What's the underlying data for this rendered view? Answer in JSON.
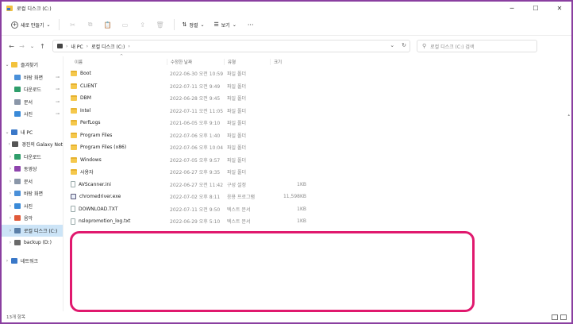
{
  "window": {
    "title": "로컬 디스크 (C:)",
    "minimize": "─",
    "maximize": "☐",
    "close": "✕"
  },
  "toolbar": {
    "new_label": "새로 만들기",
    "sort_label": "정렬",
    "view_label": "보기",
    "more": "···"
  },
  "address": {
    "crumbs": [
      "내 PC",
      "로컬 디스크 (C:)"
    ],
    "search_placeholder": "로컬 디스크 (C:) 검색"
  },
  "sidebar": {
    "items": [
      {
        "label": "즐겨찾기",
        "icon": "star-icon",
        "color": "#f3c23c",
        "arrow": "⌄",
        "indent": 0
      },
      {
        "label": "바탕 화면",
        "icon": "desktop-icon",
        "color": "#4a90d9",
        "arrow": "",
        "indent": 1,
        "pinned": true
      },
      {
        "label": "다운로드",
        "icon": "download-icon",
        "color": "#2f9e6b",
        "arrow": "",
        "indent": 1,
        "pinned": true
      },
      {
        "label": "문서",
        "icon": "document-icon",
        "color": "#8a96a8",
        "arrow": "",
        "indent": 1,
        "pinned": true
      },
      {
        "label": "사진",
        "icon": "picture-icon",
        "color": "#3a8ad8",
        "arrow": "",
        "indent": 1,
        "pinned": true
      },
      {
        "label": "내 PC",
        "icon": "pc-icon",
        "color": "#3a78c8",
        "arrow": "⌄",
        "indent": 0,
        "gap": true
      },
      {
        "label": "경진의 Galaxy Not",
        "icon": "phone-icon",
        "color": "#555555",
        "arrow": "›",
        "indent": 1
      },
      {
        "label": "다운로드",
        "icon": "download-icon",
        "color": "#2f9e6b",
        "arrow": "›",
        "indent": 1
      },
      {
        "label": "동영상",
        "icon": "video-icon",
        "color": "#8e44ad",
        "arrow": "›",
        "indent": 1
      },
      {
        "label": "문서",
        "icon": "document-icon",
        "color": "#8a96a8",
        "arrow": "›",
        "indent": 1
      },
      {
        "label": "바탕 화면",
        "icon": "desktop-icon",
        "color": "#4a90d9",
        "arrow": "›",
        "indent": 1
      },
      {
        "label": "사진",
        "icon": "picture-icon",
        "color": "#3a8ad8",
        "arrow": "›",
        "indent": 1
      },
      {
        "label": "음악",
        "icon": "music-icon",
        "color": "#e05a3a",
        "arrow": "›",
        "indent": 1
      },
      {
        "label": "로컬 디스크 (C:)",
        "icon": "drive-icon",
        "color": "#5a7fa8",
        "arrow": "›",
        "indent": 1,
        "selected": true
      },
      {
        "label": "backup (D:)",
        "icon": "drive-icon",
        "color": "#6a6a6a",
        "arrow": "›",
        "indent": 1
      },
      {
        "label": "네트워크",
        "icon": "network-icon",
        "color": "#3a78c8",
        "arrow": "›",
        "indent": 0,
        "gap": true
      }
    ]
  },
  "columns": {
    "name": "이름",
    "date": "수정한 날짜",
    "type": "유형",
    "size": "크기"
  },
  "files": [
    {
      "name": "Boot",
      "date": "2022-06-30 오전 10:59",
      "type": "파일 폴더",
      "size": "",
      "kind": "folder"
    },
    {
      "name": "CLIENT",
      "date": "2022-07-11 오전 9:49",
      "type": "파일 폴더",
      "size": "",
      "kind": "folder"
    },
    {
      "name": "DBM",
      "date": "2022-06-28 오전 9:45",
      "type": "파일 폴더",
      "size": "",
      "kind": "folder"
    },
    {
      "name": "Intel",
      "date": "2022-07-11 오전 11:05",
      "type": "파일 폴더",
      "size": "",
      "kind": "folder"
    },
    {
      "name": "PerfLogs",
      "date": "2021-06-05 오후 9:10",
      "type": "파일 폴더",
      "size": "",
      "kind": "folder"
    },
    {
      "name": "Program Files",
      "date": "2022-07-06 오후 1:40",
      "type": "파일 폴더",
      "size": "",
      "kind": "folder"
    },
    {
      "name": "Program Files (x86)",
      "date": "2022-07-06 오후 10:04",
      "type": "파일 폴더",
      "size": "",
      "kind": "folder"
    },
    {
      "name": "Windows",
      "date": "2022-07-05 오후 9:57",
      "type": "파일 폴더",
      "size": "",
      "kind": "folder"
    },
    {
      "name": "사용자",
      "date": "2022-06-27 오후 9:35",
      "type": "파일 폴더",
      "size": "",
      "kind": "folder"
    },
    {
      "name": "AVScanner.ini",
      "date": "2022-06-27 오전 11:42",
      "type": "구성 설정",
      "size": "1KB",
      "kind": "file"
    },
    {
      "name": "chromedriver.exe",
      "date": "2022-07-02 오후 8:11",
      "type": "응용 프로그램",
      "size": "11,598KB",
      "kind": "exe"
    },
    {
      "name": "DOWNLOAD.TXT",
      "date": "2022-07-11 오전 9:50",
      "type": "텍스트 문서",
      "size": "1KB",
      "kind": "file"
    },
    {
      "name": "nslopromotion_log.txt",
      "date": "2022-06-29 오후 5:10",
      "type": "텍스트 문서",
      "size": "1KB",
      "kind": "file"
    }
  ],
  "status": {
    "count": "13개 항목"
  },
  "highlight_color": "#e0196e"
}
